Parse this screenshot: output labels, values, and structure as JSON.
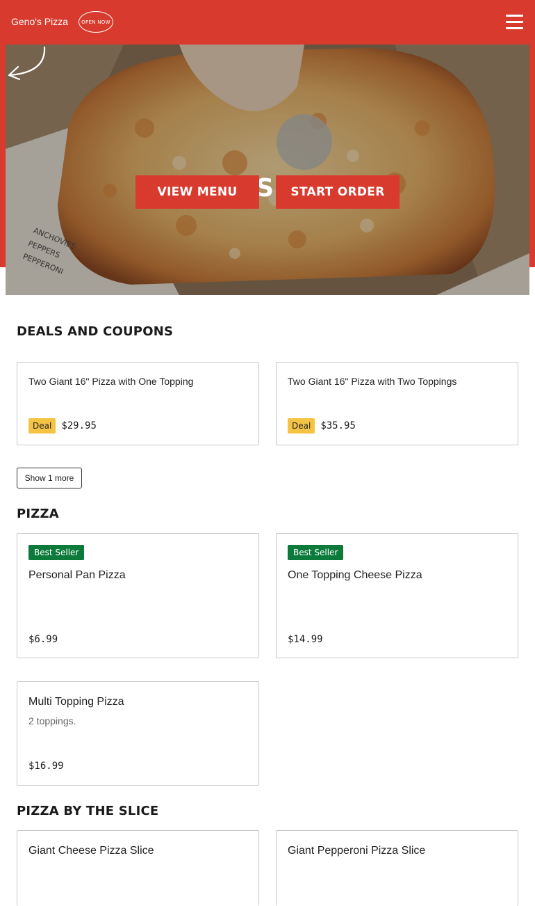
{
  "header": {
    "brand": "Geno's Pizza",
    "open_badge": "OPEN NOW"
  },
  "hero": {
    "title": "GENO'S PIZZA",
    "view_menu": "VIEW MENU",
    "start_order": "START ORDER",
    "box_print": [
      "ANCHOVIES",
      "PEPPERS",
      "PEPPERONI"
    ]
  },
  "deals": {
    "title": "DEALS AND COUPONS",
    "items": [
      {
        "name": "Two Giant 16\" Pizza with One Topping",
        "badge": "Deal",
        "price": "$29.95"
      },
      {
        "name": "Two Giant 16\" Pizza with Two Toppings",
        "badge": "Deal",
        "price": "$35.95"
      }
    ],
    "show_more": "Show 1 more"
  },
  "pizza": {
    "title": "PIZZA",
    "items": [
      {
        "badge": "Best Seller",
        "name": "Personal Pan Pizza",
        "price": "$6.99"
      },
      {
        "badge": "Best Seller",
        "name": "One Topping Cheese Pizza",
        "price": "$14.99"
      },
      {
        "name": "Multi Topping Pizza",
        "description": "2 toppings.",
        "price": "$16.99"
      }
    ]
  },
  "slices": {
    "title": "PIZZA BY THE SLICE",
    "items": [
      {
        "name": "Giant Cheese Pizza Slice"
      },
      {
        "name": "Giant Pepperoni Pizza Slice"
      }
    ]
  },
  "colors": {
    "brand_red": "#d93a2e",
    "deal_yellow": "#f6c445",
    "best_seller_green": "#0b7a3b"
  }
}
